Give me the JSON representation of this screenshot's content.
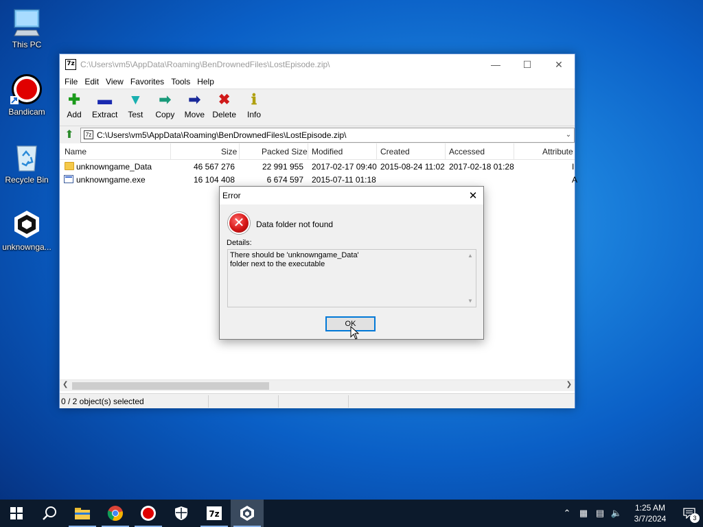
{
  "desktop": {
    "icons": [
      {
        "label": "This PC",
        "icon": "computer-icon"
      },
      {
        "label": "Bandicam",
        "icon": "record-icon"
      },
      {
        "label": "Recycle Bin",
        "icon": "recycle-bin-icon"
      },
      {
        "label": "unknownga...",
        "icon": "unity-icon"
      }
    ]
  },
  "zipwin": {
    "title": "C:\\Users\\vm5\\AppData\\Roaming\\BenDrownedFiles\\LostEpisode.zip\\",
    "app_icon": "7z",
    "menu": [
      "File",
      "Edit",
      "View",
      "Favorites",
      "Tools",
      "Help"
    ],
    "toolbar": [
      {
        "label": "Add",
        "glyph": "✚",
        "color": "#1a9a1a"
      },
      {
        "label": "Extract",
        "glyph": "▬",
        "color": "#1a2ab0"
      },
      {
        "label": "Test",
        "glyph": "▼",
        "color": "#1ab0b0"
      },
      {
        "label": "Copy",
        "glyph": "➡",
        "color": "#1a9a7a"
      },
      {
        "label": "Move",
        "glyph": "➡",
        "color": "#1a2a9a"
      },
      {
        "label": "Delete",
        "glyph": "✖",
        "color": "#d01a1a"
      },
      {
        "label": "Info",
        "glyph": "ℹ",
        "color": "#b0a010"
      }
    ],
    "address": "C:\\Users\\vm5\\AppData\\Roaming\\BenDrownedFiles\\LostEpisode.zip\\",
    "columns": {
      "name": "Name",
      "size": "Size",
      "packed": "Packed Size",
      "modified": "Modified",
      "created": "Created",
      "accessed": "Accessed",
      "attributes": "Attribute"
    },
    "rows": [
      {
        "name": "unknowngame_Data",
        "size": "46 567 276",
        "packed": "22 991 955",
        "modified": "2017-02-17 09:40",
        "created": "2015-08-24 11:02",
        "accessed": "2017-02-18 01:28",
        "attr": "I",
        "type": "folder"
      },
      {
        "name": "unknowngame.exe",
        "size": "16 104 408",
        "packed": "6 674 597",
        "modified": "2015-07-11 01:18",
        "created": "",
        "accessed": "",
        "attr": "A",
        "type": "exe"
      }
    ],
    "status": "0 / 2 object(s) selected"
  },
  "dialog": {
    "title": "Error",
    "message": "Data folder not found",
    "details_label": "Details:",
    "details_line1": "There should be 'unknowngame_Data'",
    "details_line2": "folder next to the executable",
    "ok": "OK"
  },
  "taskbar": {
    "apps": [
      "start",
      "search",
      "file-explorer",
      "chrome",
      "bandicam",
      "security",
      "7zip",
      "unity"
    ],
    "time": "1:25 AM",
    "date": "3/7/2024",
    "notifications": "3"
  }
}
